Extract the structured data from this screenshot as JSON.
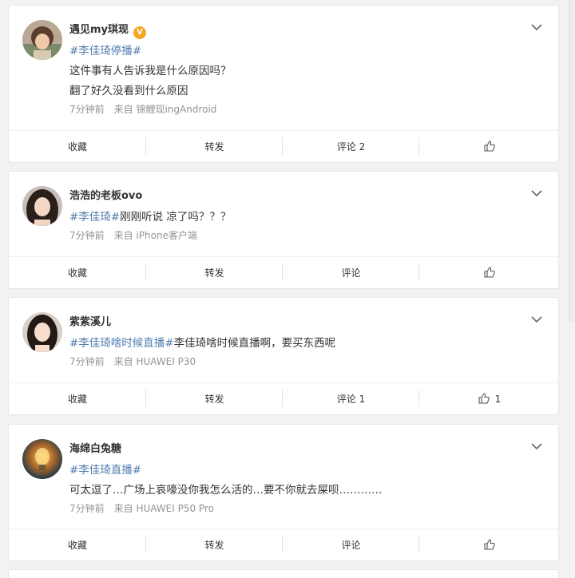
{
  "posts": [
    {
      "user": "遇见my琪现",
      "verified": true,
      "avatar": "avatar-child-icon",
      "lines": [
        {
          "tag": "#李佳琦停播#",
          "text": ""
        },
        {
          "tag": "",
          "text": "这件事有人告诉我是什么原因吗？"
        },
        {
          "tag": "",
          "text": "翻了好久没看到什么原因"
        }
      ],
      "time": "7分钟前",
      "source": "来自 锦鲤现ingAndroid",
      "actions": {
        "collect": "收藏",
        "repost": "转发",
        "comment": "评论 2",
        "like": ""
      }
    },
    {
      "user": "浩浩的老板ovo",
      "verified": false,
      "avatar": "avatar-woman-icon",
      "lines": [
        {
          "tag": "#李佳琦#",
          "text": "刚刚听说 凉了吗？？？"
        }
      ],
      "time": "7分钟前",
      "source": "来自 iPhone客户端",
      "actions": {
        "collect": "收藏",
        "repost": "转发",
        "comment": "评论",
        "like": ""
      }
    },
    {
      "user": "紫紫溪儿",
      "verified": false,
      "avatar": "avatar-woman-icon",
      "lines": [
        {
          "tag": "#李佳琦啥时候直播#",
          "text": "李佳琦啥时候直播啊，要买东西呢"
        }
      ],
      "time": "7分钟前",
      "source": "来自 HUAWEI P30",
      "actions": {
        "collect": "收藏",
        "repost": "转发",
        "comment": "评论 1",
        "like": "1"
      }
    },
    {
      "user": "海绵白兔糖",
      "verified": false,
      "avatar": "avatar-lightbulb-icon",
      "lines": [
        {
          "tag": "#李佳琦直播#",
          "text": ""
        },
        {
          "tag": "",
          "text": "可太逗了…广场上哀嚎没你我怎么活的…要不你就去屎呗…………"
        }
      ],
      "time": "7分钟前",
      "source": "来自 HUAWEI P50 Pro",
      "actions": {
        "collect": "收藏",
        "repost": "转发",
        "comment": "评论",
        "like": ""
      }
    }
  ],
  "colors": {
    "accent": "#507daf",
    "badge": "#f5a623",
    "meta": "#939393"
  }
}
